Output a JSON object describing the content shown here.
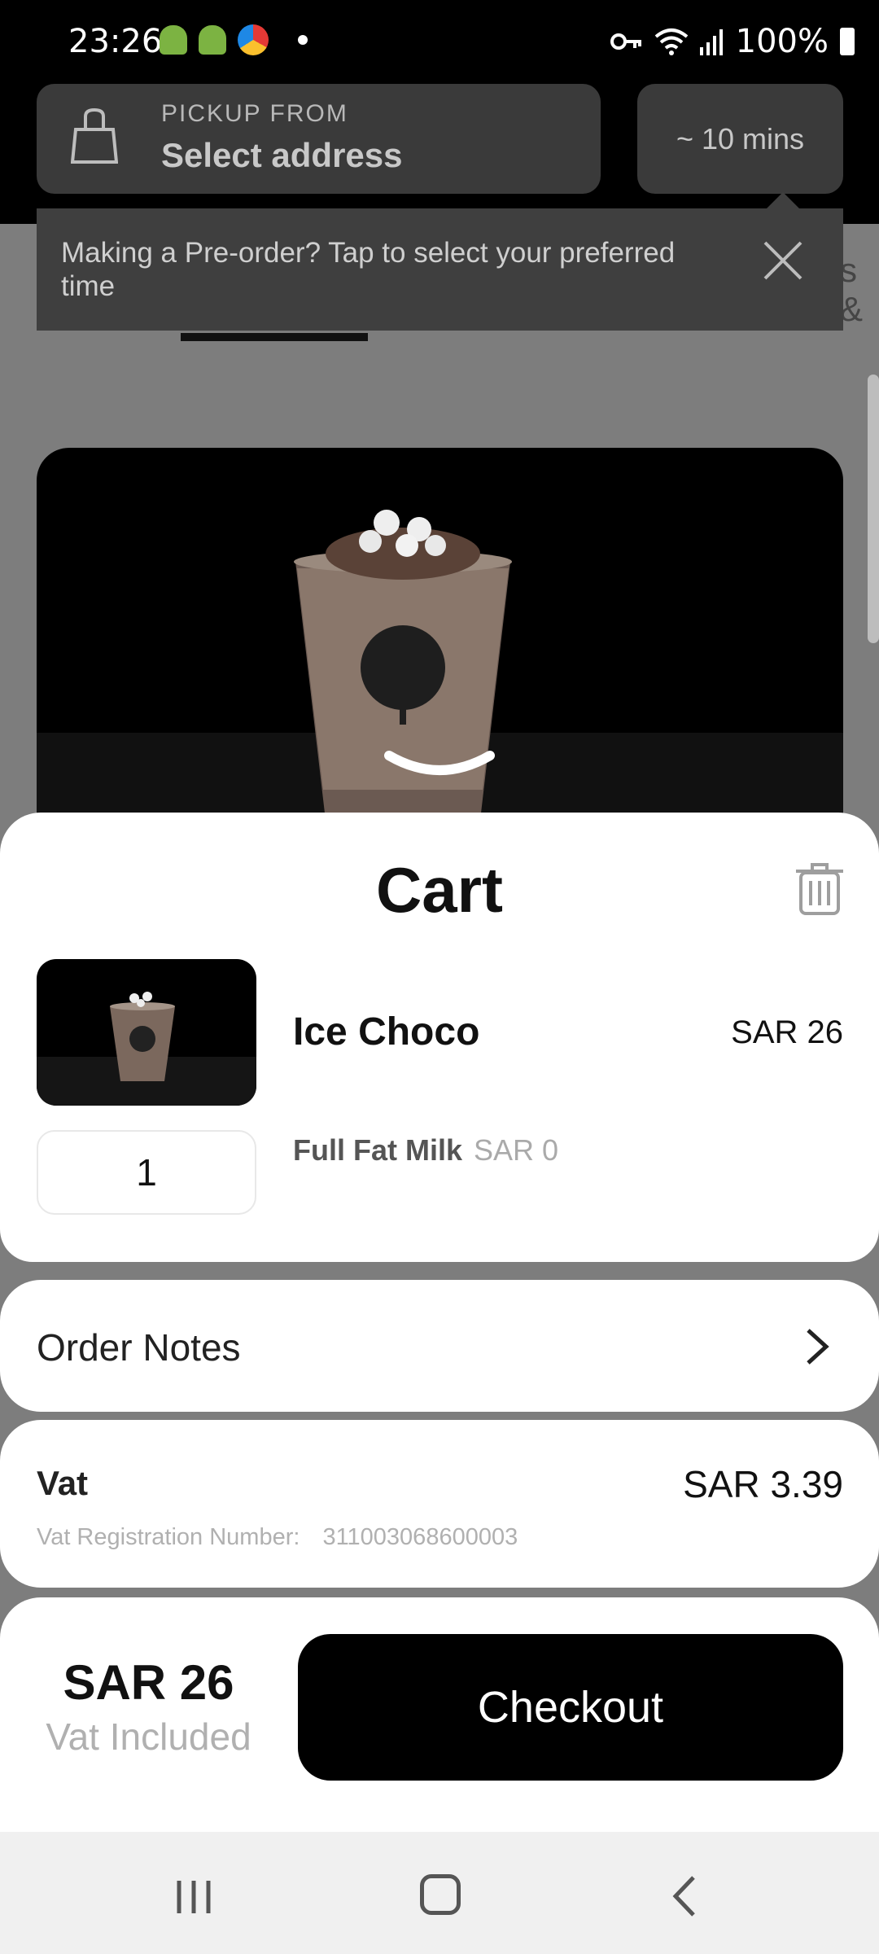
{
  "status_bar": {
    "time": "23:26",
    "battery": "100%"
  },
  "header": {
    "pickup_label": "PICKUP FROM",
    "pickup_value": "Select address",
    "eta": "~ 10 mins"
  },
  "tooltip": {
    "text": "Making a Pre-order? Tap to select your preferred time"
  },
  "background": {
    "partial_tab_text": "s &"
  },
  "cart": {
    "title": "Cart",
    "item": {
      "name": "Ice Choco",
      "price": "SAR 26",
      "quantity": "1",
      "modifier_name": "Full Fat Milk",
      "modifier_price": "SAR 0"
    },
    "order_notes_label": "Order Notes",
    "vat": {
      "label": "Vat",
      "value": "SAR 3.39",
      "reg_label": "Vat Registration Number:",
      "reg_number": "311003068600003"
    },
    "footer": {
      "total": "SAR 26",
      "vat_note": "Vat Included",
      "checkout_label": "Checkout"
    }
  },
  "icons": [
    "android-icon",
    "chrome-icon",
    "key-icon",
    "wifi-icon",
    "signal-icon",
    "battery-icon",
    "bag-icon",
    "close-icon",
    "chevron-down-icon",
    "trash-icon",
    "chevron-right-icon",
    "recent-apps-icon",
    "home-icon",
    "back-icon"
  ]
}
